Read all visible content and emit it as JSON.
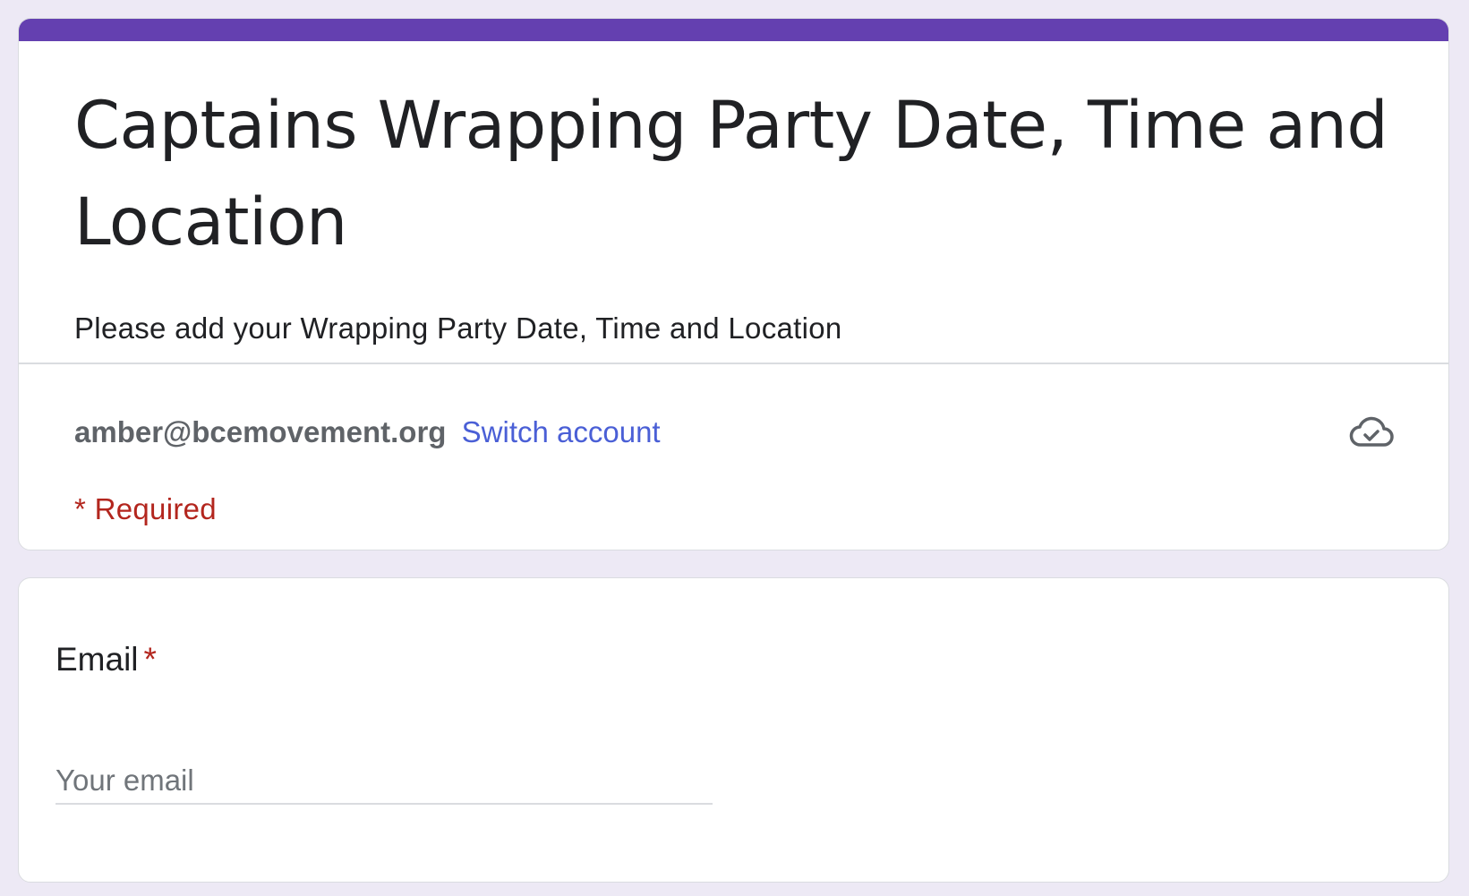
{
  "form": {
    "title": "Captains Wrapping Party Date, Time and Location",
    "description": "Please add your Wrapping Party Date, Time and Location",
    "accent_color": "#6440b0",
    "account": {
      "email": "amber@bcemovement.org",
      "switch_label": "Switch account",
      "status_icon": "cloud-check-icon"
    },
    "required_note": "* Required"
  },
  "questions": [
    {
      "label": "Email",
      "required_marker": "*",
      "placeholder": "Your email",
      "value": ""
    }
  ]
}
